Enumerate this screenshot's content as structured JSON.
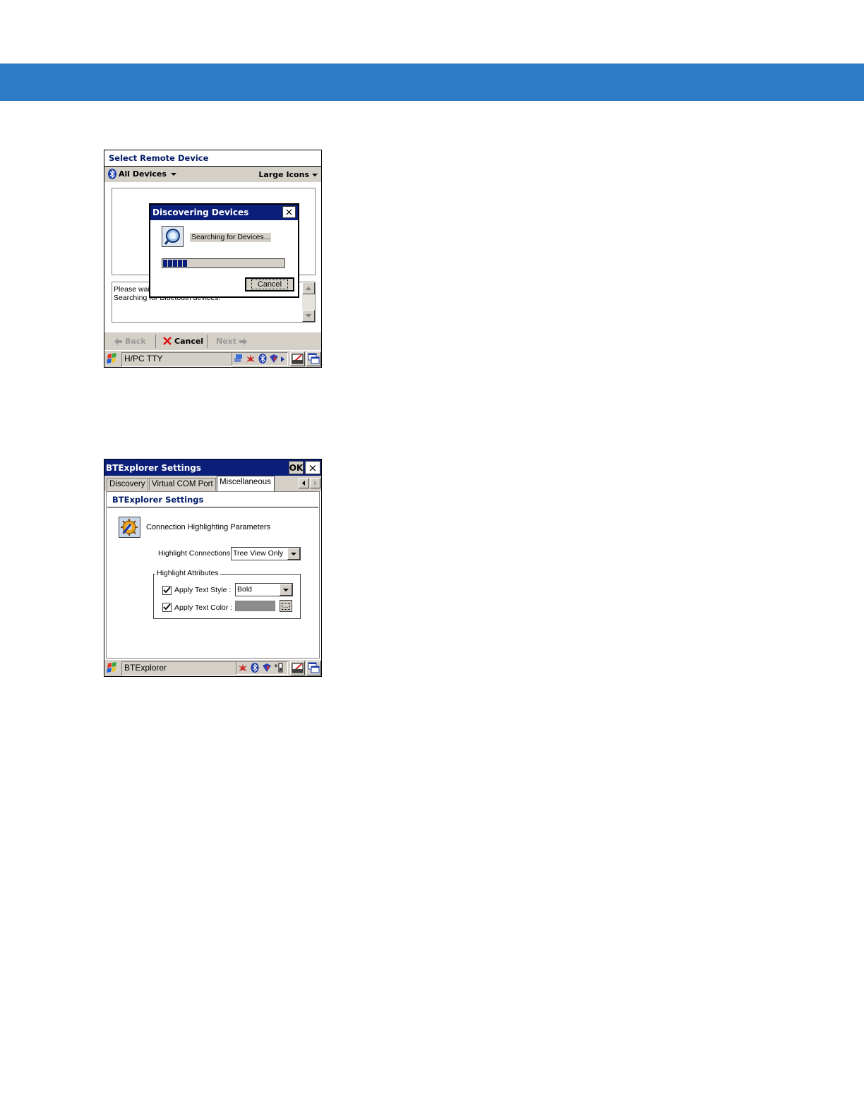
{
  "screen1": {
    "header_title": "Select Remote Device",
    "filter_dropdown": "All Devices",
    "view_dropdown": "Large Icons",
    "dialog": {
      "title": "Discovering Devices",
      "close": "×",
      "status_text": "Searching for Devices...",
      "progress_percent": 20,
      "cancel_label": "Cancel"
    },
    "status_log": [
      "Please wait...",
      "Searching for Bluetooth devices."
    ],
    "nav": {
      "back": "Back",
      "cancel": "Cancel",
      "next": "Next"
    },
    "taskbar": {
      "active_app": "H/PC TTY"
    }
  },
  "screen2": {
    "window_title": "BTExplorer Settings",
    "ok_label": "OK",
    "close_label": "×",
    "tabs": [
      "Discovery",
      "Virtual COM Port",
      "Miscellaneous"
    ],
    "active_tab": "Miscellaneous",
    "section_title": "BTExplorer Settings",
    "params_heading": "Connection Highlighting Parameters",
    "highlight_connections_label": "Highlight Connections",
    "highlight_connections_value": "Tree View Only",
    "group_title": "Highlight Attributes",
    "apply_text_style_label": "Apply Text Style :",
    "apply_text_style_checked": true,
    "text_style_value": "Bold",
    "apply_text_color_label": "Apply Text Color :",
    "apply_text_color_checked": true,
    "text_color": "#8c8c8c",
    "color_picker_label": "...",
    "taskbar": {
      "active_app": "BTExplorer"
    }
  },
  "colors": {
    "banner": "#2e7bc8",
    "titlebar": "#0a1e7a",
    "accent_text": "#001a66"
  }
}
